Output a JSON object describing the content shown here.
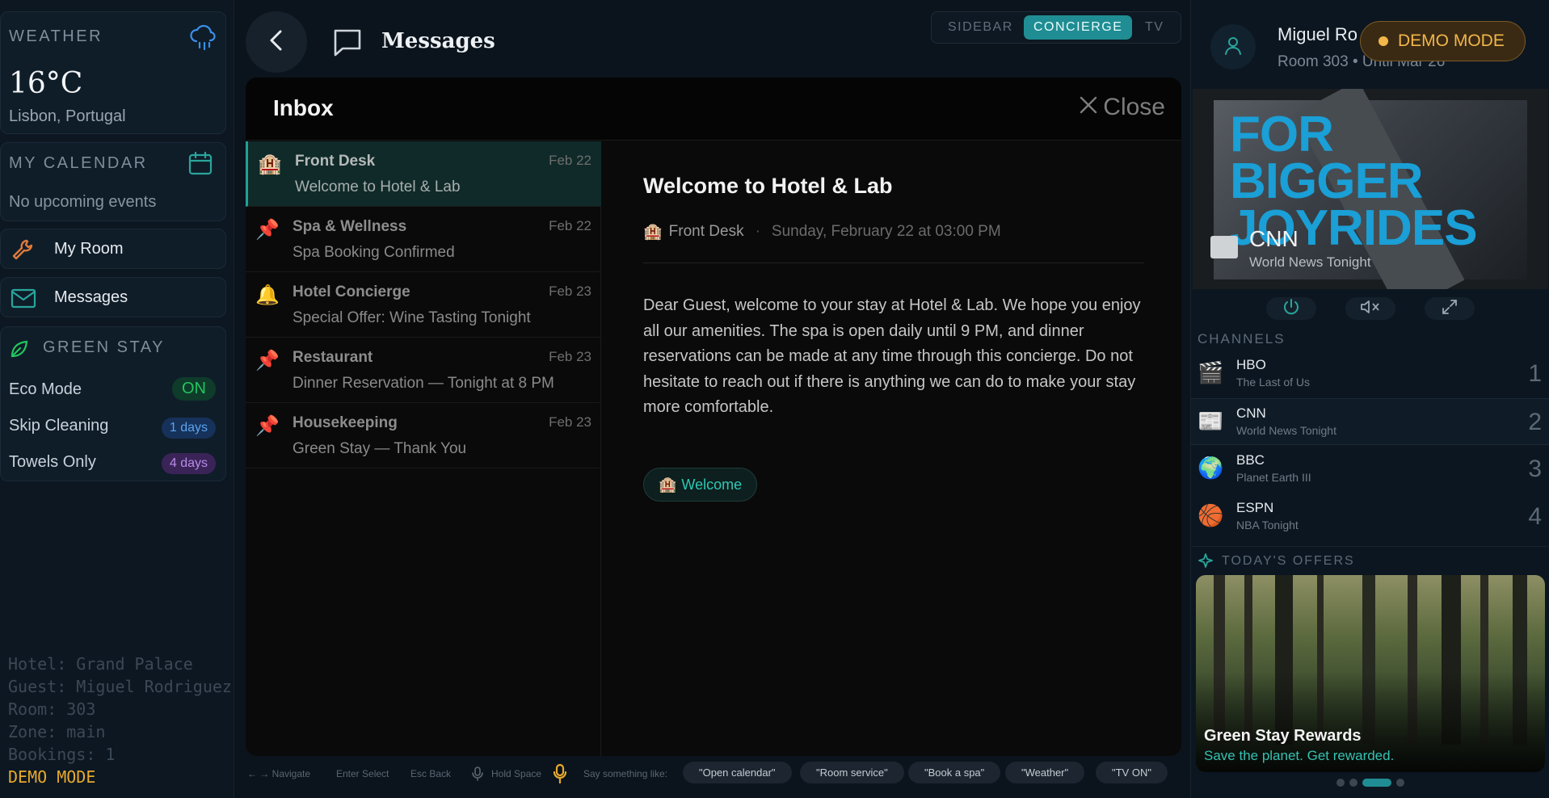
{
  "weather": {
    "title": "WEATHER",
    "temperature": "16°C",
    "location": "Lisbon, Portugal",
    "icon": "rain-cloud-icon"
  },
  "calendar": {
    "title": "MY CALENDAR",
    "empty_text": "No upcoming events",
    "icon": "calendar-icon"
  },
  "nav": {
    "my_room": "My Room",
    "messages": "Messages"
  },
  "green_stay": {
    "title": "GREEN STAY",
    "rows": [
      {
        "label": "Eco Mode",
        "value": "ON"
      },
      {
        "label": "Skip Cleaning",
        "value": "1 days"
      },
      {
        "label": "Towels Only",
        "value": "4 days"
      }
    ]
  },
  "debug": {
    "hotel": "Hotel: Grand Palace",
    "guest": "Guest: Miguel Rodriguez",
    "room": "Room: 303",
    "zone": "Zone: main",
    "bookings": "Bookings: 1",
    "mode": "DEMO MODE"
  },
  "header": {
    "title": "Messages",
    "modes": [
      "SIDEBAR",
      "CONCIERGE",
      "TV"
    ],
    "active_mode": "CONCIERGE"
  },
  "inbox": {
    "title": "Inbox",
    "close_label": "Close",
    "messages": [
      {
        "emoji": "🏨",
        "from": "Front Desk",
        "date": "Feb 22",
        "subject": "Welcome to Hotel & Lab"
      },
      {
        "emoji": "📌",
        "from": "Spa & Wellness",
        "date": "Feb 22",
        "subject": "Spa Booking Confirmed"
      },
      {
        "emoji": "🔔",
        "from": "Hotel Concierge",
        "date": "Feb 23",
        "subject": "Special Offer: Wine Tasting Tonight"
      },
      {
        "emoji": "📌",
        "from": "Restaurant",
        "date": "Feb 23",
        "subject": "Dinner Reservation — Tonight at 8 PM"
      },
      {
        "emoji": "📌",
        "from": "Housekeeping",
        "date": "Feb 23",
        "subject": "Green Stay — Thank You"
      }
    ]
  },
  "detail": {
    "title": "Welcome to Hotel & Lab",
    "sender_emoji": "🏨",
    "sender": "Front Desk",
    "separator": "·",
    "date": "Sunday, February 22 at 03:00 PM",
    "body": "Dear Guest, welcome to your stay at Hotel & Lab. We hope you enjoy all our amenities. The spa is open daily until 9 PM, and dinner reservations can be made at any time through this concierge. Do not hesitate to reach out if there is anything we can do to make your stay more comfortable.",
    "tag_emoji": "🏨",
    "tag": "Welcome"
  },
  "hints": {
    "navigate": "← → Navigate",
    "select": "Enter Select",
    "back": "Esc Back",
    "hold": "Hold Space",
    "say": "Say something like:",
    "chips": [
      "\"Open calendar\"",
      "\"Room service\"",
      "\"Book a spa\"",
      "\"Weather\"",
      "\"TV ON\""
    ]
  },
  "guest": {
    "name": "Miguel Ro",
    "room": "Room 303 • Until Mar 26",
    "demo_badge": "DEMO MODE"
  },
  "tv": {
    "banner_line1": "FOR",
    "banner_line2": "BIGGER",
    "banner_line3": "JOYRIDES",
    "channel": "CNN",
    "program": "World News Tonight",
    "channels_title": "CHANNELS",
    "channels": [
      {
        "emoji": "🎬",
        "name": "HBO",
        "program": "The Last of Us",
        "number": "1"
      },
      {
        "emoji": "📰",
        "name": "CNN",
        "program": "World News Tonight",
        "number": "2"
      },
      {
        "emoji": "🌍",
        "name": "BBC",
        "program": "Planet Earth III",
        "number": "3"
      },
      {
        "emoji": "🏀",
        "name": "ESPN",
        "program": "NBA Tonight",
        "number": "4"
      }
    ]
  },
  "offers": {
    "title": "TODAY'S OFFERS",
    "card_title": "Green Stay Rewards",
    "card_subtitle": "Save the planet. Get rewarded.",
    "active_index": 2,
    "total": 4
  },
  "colors": {
    "accent_teal": "#1f8d93",
    "demo_amber": "#f2b64a",
    "eco_green": "#22c55e"
  }
}
